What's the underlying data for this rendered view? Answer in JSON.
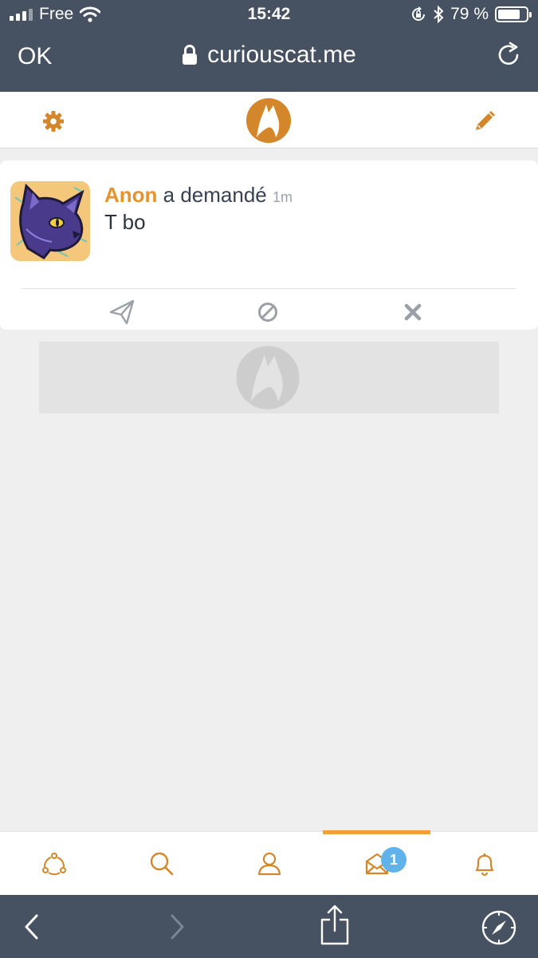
{
  "status_bar": {
    "carrier": "Free",
    "time": "15:42",
    "battery": "79 %",
    "battery_level": 0.79
  },
  "browser": {
    "done_label": "OK",
    "url": "curiouscat.me"
  },
  "question": {
    "author": "Anon",
    "verb": "a demandé",
    "time": "1m",
    "text": "T bo"
  },
  "tabs": {
    "active": "inbox",
    "inbox_badge": "1"
  },
  "colors": {
    "accent": "#e5922f",
    "chrome": "#465162",
    "badge": "#5fb2ea",
    "background": "#efefef"
  },
  "icons": [
    "settings-gear-icon",
    "curiouscat-logo",
    "edit-pencil-icon",
    "send-icon",
    "block-icon",
    "delete-x-icon",
    "network-icon",
    "search-icon",
    "profile-icon",
    "inbox-icon",
    "bell-icon",
    "back-chevron-icon",
    "forward-chevron-icon",
    "share-icon",
    "compass-icon",
    "lock-icon",
    "reload-icon",
    "wifi-icon",
    "bluetooth-icon",
    "orientation-lock-icon"
  ]
}
